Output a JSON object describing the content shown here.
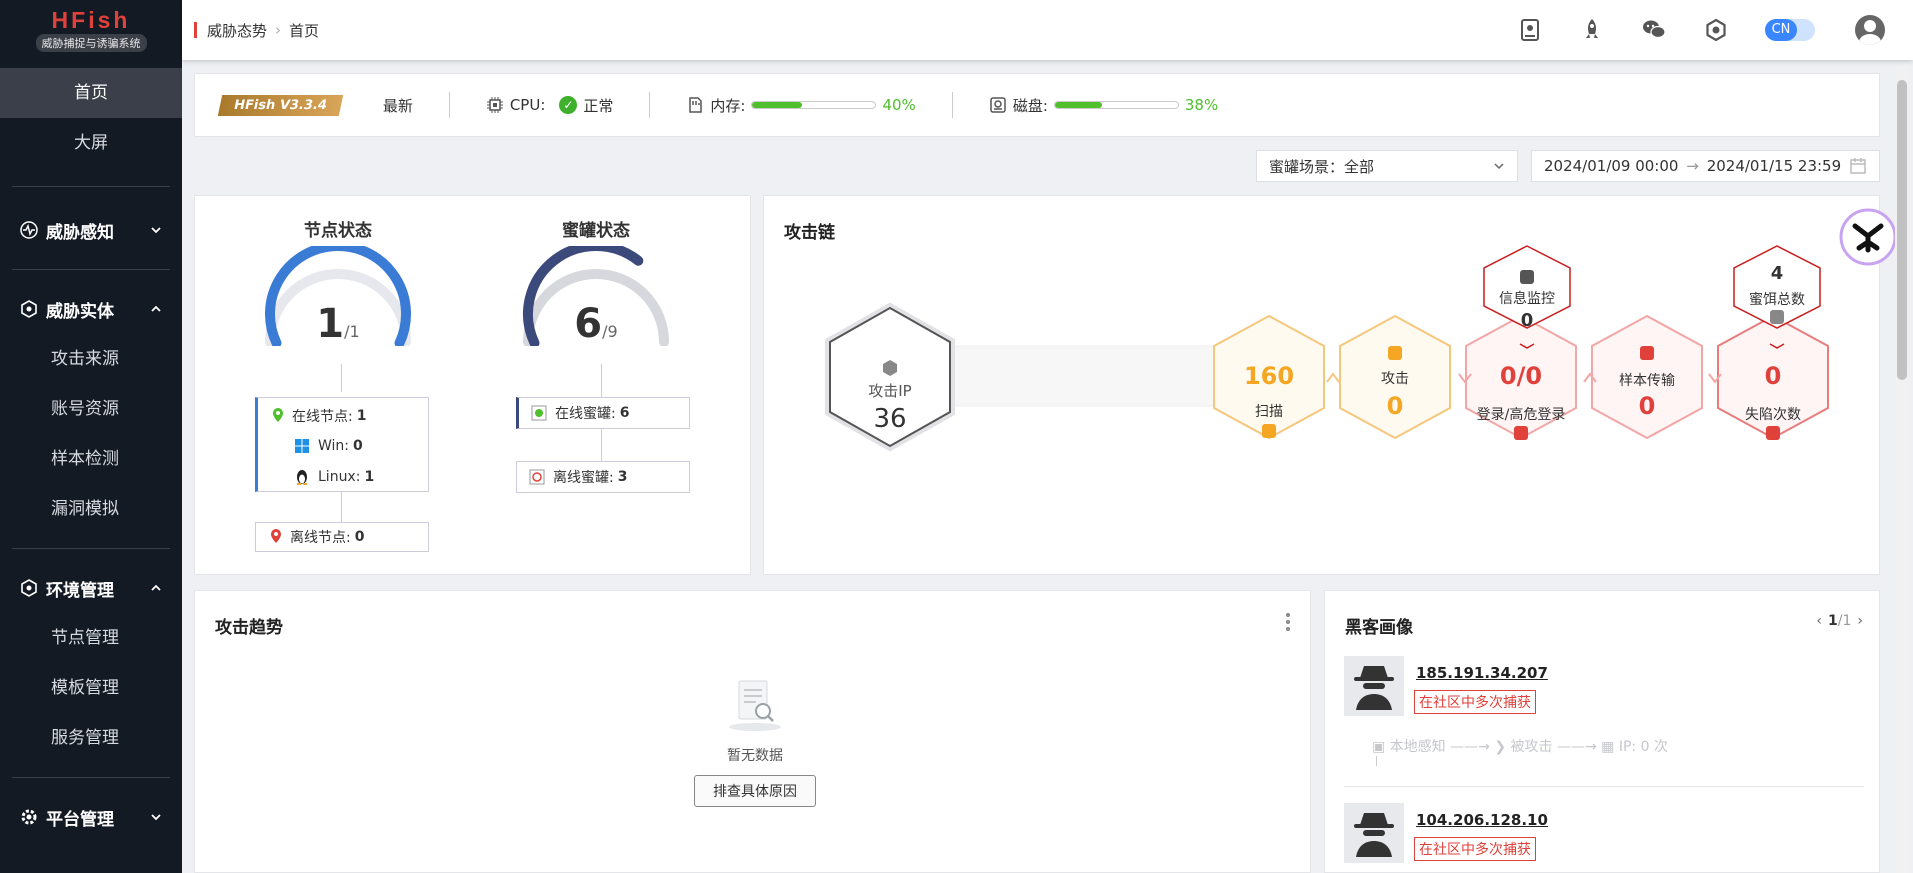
{
  "logo": {
    "title": "HFish",
    "subtitle": "威胁捕捉与诱骗系统"
  },
  "nav": {
    "home": "首页",
    "screen": "大屏",
    "groups": [
      {
        "label": "威胁感知",
        "expanded": false,
        "items": []
      },
      {
        "label": "威胁实体",
        "expanded": true,
        "items": [
          "攻击来源",
          "账号资源",
          "样本检测",
          "漏洞模拟"
        ]
      },
      {
        "label": "环境管理",
        "expanded": true,
        "items": [
          "节点管理",
          "模板管理",
          "服务管理"
        ]
      },
      {
        "label": "平台管理",
        "expanded": false,
        "items": []
      }
    ]
  },
  "breadcrumb": {
    "parent": "威胁态势",
    "current": "首页"
  },
  "topbar": {
    "lang": "CN"
  },
  "status": {
    "version": "HFish V3.3.4",
    "latest": "最新",
    "cpu_label": "CPU:",
    "cpu_status": "正常",
    "mem_label": "内存:",
    "mem_pct": "40%",
    "mem_value": 0.4,
    "disk_label": "磁盘:",
    "disk_pct": "38%",
    "disk_value": 0.38
  },
  "filters": {
    "scene": "蜜罐场景：全部",
    "date_from": "2024/01/09 00:00",
    "date_to": "2024/01/15 23:59"
  },
  "node_status": {
    "title": "节点状态",
    "value": "1",
    "total": "/1",
    "online_label": "在线节点:",
    "online": "1",
    "win_label": "Win:",
    "win": "0",
    "linux_label": "Linux:",
    "linux": "1",
    "offline_label": "离线节点:",
    "offline": "0",
    "fraction": 1.0
  },
  "honeypot_status": {
    "title": "蜜罐状态",
    "value": "6",
    "total": "/9",
    "online_label": "在线蜜罐:",
    "online": "6",
    "offline_label": "离线蜜罐:",
    "offline": "3",
    "fraction": 0.667
  },
  "attack_chain": {
    "title": "攻击链",
    "attack_ip_label": "攻击IP",
    "attack_ip": "36",
    "scan_value": "160",
    "scan_label": "扫描",
    "attack_label": "攻击",
    "attack_value": "0",
    "login_value": "0/0",
    "login_label": "登录/高危登录",
    "sample_label": "样本传输",
    "sample_value": "0",
    "trap_value": "0",
    "trap_label": "失陷次数",
    "monitor_label": "信息监控",
    "monitor_value": "0",
    "bait_value": "4",
    "bait_label": "蜜饵总数",
    "colors": {
      "scan": "#f5a623",
      "attack": "#f5a623",
      "login": "#e0413a",
      "sample": "#e0413a",
      "trap": "#e0413a"
    }
  },
  "trend": {
    "title": "攻击趋势",
    "empty": "暂无数据",
    "button": "排查具体原因"
  },
  "hackers": {
    "title": "黑客画像",
    "page": "1",
    "pages": "/1",
    "items": [
      {
        "ip": "185.191.34.207",
        "tag": "在社区中多次捕获",
        "flow_local": "本地感知",
        "flow_attacked": "被攻击",
        "flow_ip": "IP: 0 次"
      },
      {
        "ip": "104.206.128.10",
        "tag": "在社区中多次捕获"
      }
    ]
  }
}
